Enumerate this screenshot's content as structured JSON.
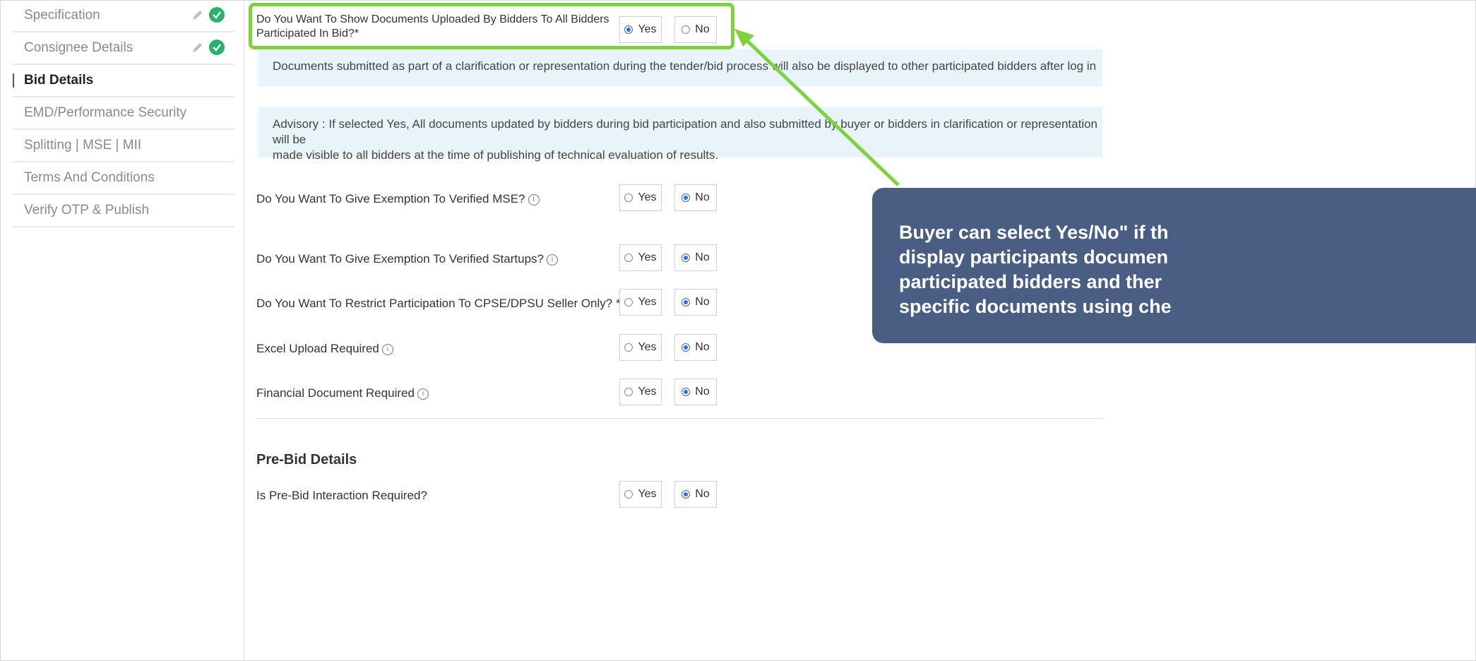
{
  "sidebar": {
    "items": [
      {
        "label": "Specification",
        "state": "done"
      },
      {
        "label": "Consignee Details",
        "state": "done"
      },
      {
        "label": "Bid Details",
        "state": "active"
      },
      {
        "label": "EMD/Performance Security",
        "state": "pending"
      },
      {
        "label": "Splitting | MSE | MII",
        "state": "pending"
      },
      {
        "label": "Terms And Conditions",
        "state": "pending"
      },
      {
        "label": "Verify OTP & Publish",
        "state": "pending"
      }
    ]
  },
  "main": {
    "show_docs": {
      "question_line1": "Do You Want To Show Documents Uploaded By Bidders To All Bidders",
      "question_line2": "Participated In Bid?*",
      "selected": "Yes"
    },
    "options": {
      "yes": "Yes",
      "no": "No"
    },
    "note1": "Documents submitted as part of a clarification or representation during the tender/bid process will also be displayed to other participated bidders after log in",
    "advisory_line1": "Advisory : If selected Yes, All documents updated by bidders during bid participation and also submitted by buyer or bidders in clarification or representation will be",
    "advisory_line2": "made visible to all bidders at the time of publishing of technical evaluation of results.",
    "questions": [
      {
        "label": "Do You Want To Give Exemption To Verified MSE?",
        "info": true,
        "selected": "No"
      },
      {
        "label": "Do You Want To Give Exemption To Verified Startups?",
        "info": true,
        "selected": "No"
      },
      {
        "label": "Do You Want To Restrict Participation To CPSE/DPSU Seller Only? *",
        "info": true,
        "selected": "No"
      },
      {
        "label": "Excel Upload Required",
        "info": true,
        "selected": "No"
      },
      {
        "label": "Financial Document Required",
        "info": true,
        "selected": "No"
      }
    ],
    "prebid": {
      "section_title": "Pre-Bid Details",
      "question": "Is Pre-Bid Interaction Required?",
      "selected": "No"
    }
  },
  "annotation": {
    "callout_line1": "Buyer can select Yes/No\" if th",
    "callout_line2": "display participants documen",
    "callout_line3": "participated bidders and ther",
    "callout_line4": "specific documents using che",
    "highlight_color": "#7dd33c",
    "callout_color": "#4a5e84"
  },
  "colors": {
    "accent": "#2e6fd8",
    "success": "#27b36a",
    "note_bg": "#e9f4fa"
  }
}
